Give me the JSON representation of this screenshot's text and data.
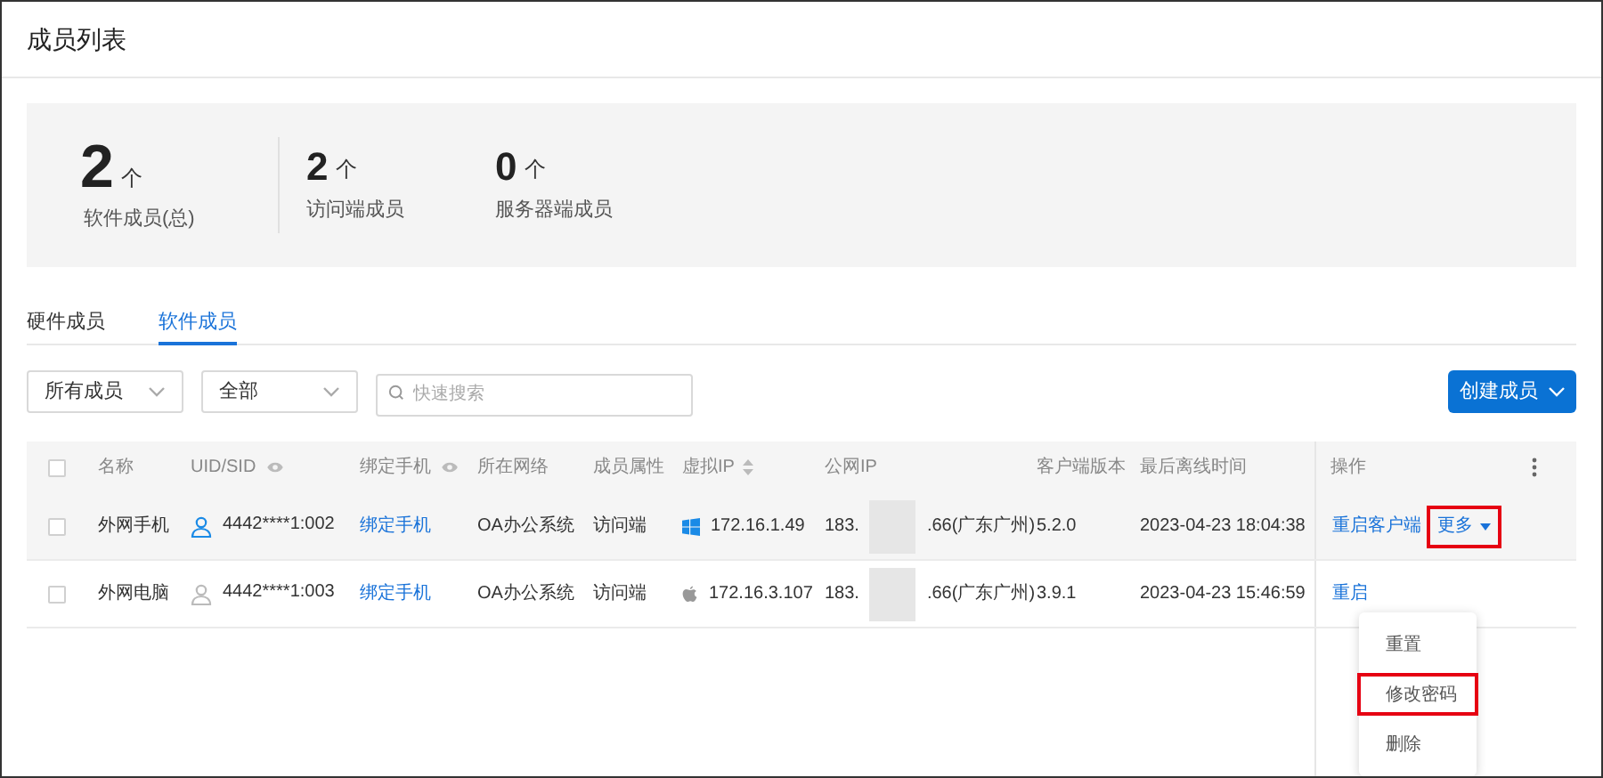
{
  "page_title": "成员列表",
  "stats": [
    {
      "value": "2",
      "unit": "个",
      "label": "软件成员(总)"
    },
    {
      "value": "2",
      "unit": "个",
      "label": "访问端成员"
    },
    {
      "value": "0",
      "unit": "个",
      "label": "服务器端成员"
    }
  ],
  "tabs": [
    {
      "label": "硬件成员",
      "selected": false
    },
    {
      "label": "软件成员",
      "selected": true
    }
  ],
  "filters": [
    {
      "value": "所有成员"
    },
    {
      "value": "全部"
    }
  ],
  "search": {
    "placeholder": "快速搜索"
  },
  "create_button": "创建成员",
  "table": {
    "header_checked": false,
    "columns": [
      {
        "label": "名称"
      },
      {
        "label": "UID/SID"
      },
      {
        "label": "绑定手机"
      },
      {
        "label": "所在网络"
      },
      {
        "label": "成员属性"
      },
      {
        "label": "虚拟IP"
      },
      {
        "label": "公网IP"
      },
      {
        "label": "客户端版本"
      },
      {
        "label": "最后离线时间"
      },
      {
        "label": "操作"
      }
    ],
    "rows": [
      {
        "hovered": true,
        "checked": false,
        "name": "外网手机",
        "online": true,
        "uid": "4442****1:002",
        "phone": "绑定手机",
        "network": "OA办公系统",
        "attribute": "访问端",
        "kind": "windows",
        "virtual_ip": "172.16.1.49",
        "public_ip_start": "183.",
        "public_ip_end": ".66(广东广州)",
        "version": "5.2.0",
        "last_offline": "2023-04-23 18:04:38",
        "actions": [
          {
            "label": "重启客户端",
            "kind": "link",
            "highlighted": false
          },
          {
            "label": "更多",
            "kind": "dropdown",
            "highlighted": true
          }
        ]
      },
      {
        "hovered": false,
        "checked": false,
        "name": "外网电脑",
        "online": false,
        "uid": "4442****1:003",
        "phone": "绑定手机",
        "network": "OA办公系统",
        "attribute": "访问端",
        "kind": "apple",
        "virtual_ip": "172.16.3.107",
        "public_ip_start": "183.",
        "public_ip_end": ".66(广东广州)",
        "version": "3.9.1",
        "last_offline": "2023-04-23 15:46:59",
        "actions": [
          {
            "label": "重启",
            "kind": "link",
            "highlighted": false
          }
        ]
      }
    ]
  },
  "menu": [
    {
      "label": "重置",
      "highlighted": false
    },
    {
      "label": "修改密码",
      "highlighted": true
    },
    {
      "label": "删除",
      "highlighted": false
    }
  ]
}
